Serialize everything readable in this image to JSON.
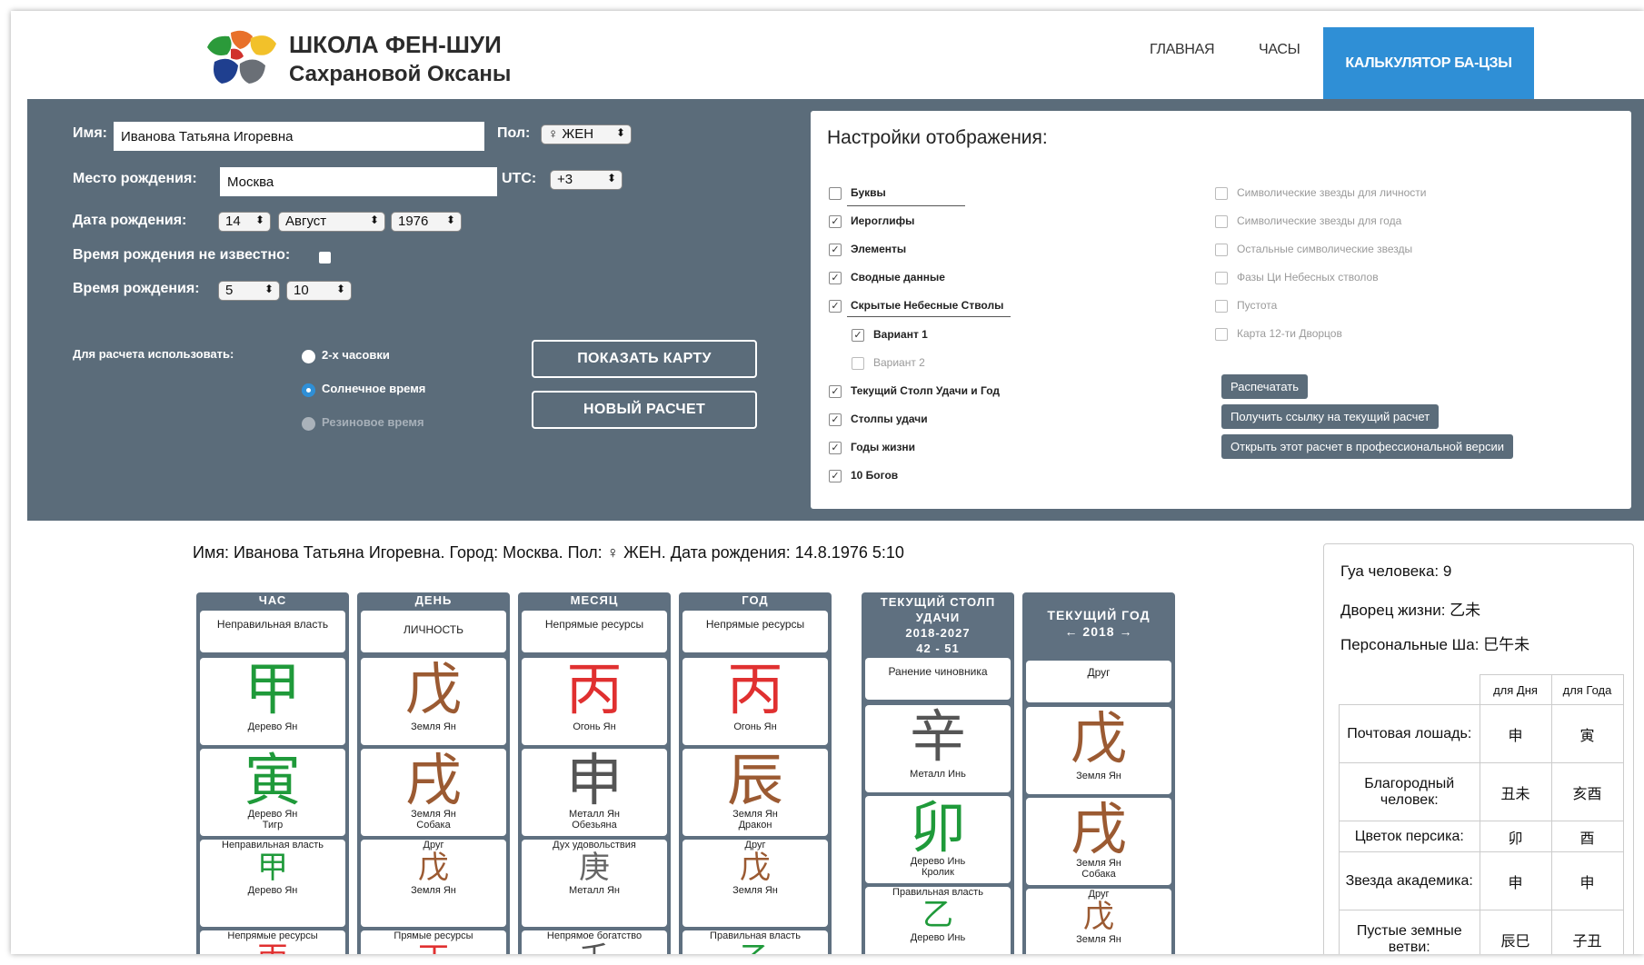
{
  "header": {
    "title": "ШКОЛА ФЕН-ШУИ",
    "subtitle": "Сахрановой Оксаны",
    "nav": [
      "ГЛАВНАЯ",
      "ЧАСЫ"
    ],
    "nav_active": "КАЛЬКУЛЯТОР БА-ЦЗЫ"
  },
  "form": {
    "name_label": "Имя:",
    "name_value": "Иванова Татьяна Игоревна",
    "gender_label": "Пол:",
    "gender_value": "♀ ЖЕН",
    "place_label": "Место рождения:",
    "place_value": "Москва",
    "utc_label": "UTC:",
    "utc_value": "+3",
    "date_label": "Дата рождения:",
    "day": "14",
    "month": "Август",
    "year": "1976",
    "time_unknown_label": "Время рождения не известно:",
    "time_label": "Время рождения:",
    "hour": "5",
    "minute": "10",
    "calc_label": "Для расчета использовать:",
    "radio": [
      "2-х часовки",
      "Солнечное время",
      "Резиновое время"
    ],
    "show_btn": "ПОКАЗАТЬ КАРТУ",
    "new_btn": "НОВЫЙ РАСЧЕТ"
  },
  "settings": {
    "title": "Настройки отображения:",
    "left": [
      {
        "label": "Буквы",
        "checked": false
      },
      {
        "label": "Иероглифы",
        "checked": true
      },
      {
        "label": "Элементы",
        "checked": true
      },
      {
        "label": "Сводные данные",
        "checked": true
      },
      {
        "label": "Скрытые Небесные Стволы",
        "checked": true
      },
      {
        "label": "Вариант 1",
        "checked": true
      },
      {
        "label": "Вариант 2",
        "checked": false
      },
      {
        "label": "Текущий Столп Удачи и Год",
        "checked": true
      },
      {
        "label": "Столпы удачи",
        "checked": true
      },
      {
        "label": "Годы жизни",
        "checked": true
      },
      {
        "label": "10 Богов",
        "checked": true
      }
    ],
    "right": [
      "Символические звезды для личности",
      "Символические звезды для года",
      "Остальные символические звезды",
      "Фазы Ци Небесных стволов",
      "Пустота",
      "Карта 12-ти Дворцов"
    ],
    "buttons": [
      "Распечатать",
      "Получить ссылку на текущий расчет",
      "Открыть этот расчет в профессиональной версии"
    ]
  },
  "summary": "Имя: Иванова Татьяна Игоревна. Город: Москва. Пол: ♀ ЖЕН. Дата рождения: 14.8.1976 5:10",
  "pillars": [
    {
      "head": "ЧАС",
      "god": "Неправильная власть",
      "stem": "甲",
      "stem_label": "Дерево Ян",
      "branch": "寅",
      "branch_label1": "Дерево Ян",
      "branch_label2": "Тигр",
      "h1_god": "Неправильная власть",
      "h1": "甲",
      "h1_label": "Дерево Ян",
      "h2_god": "Непрямые ресурсы",
      "h2": "丙"
    },
    {
      "head": "ДЕНЬ",
      "god": "ЛИЧНОСТЬ",
      "stem": "戊",
      "stem_label": "Земля Ян",
      "branch": "戌",
      "branch_label1": "Земля Ян",
      "branch_label2": "Собака",
      "h1_god": "Друг",
      "h1": "戊",
      "h1_label": "Земля Ян",
      "h2_god": "Прямые ресурсы",
      "h2": "丁"
    },
    {
      "head": "МЕСЯЦ",
      "god": "Непрямые ресурсы",
      "stem": "丙",
      "stem_label": "Огонь Ян",
      "branch": "申",
      "branch_label1": "Металл Ян",
      "branch_label2": "Обезьяна",
      "h1_god": "Дух удовольствия",
      "h1": "庚",
      "h1_label": "Металл Ян",
      "h2_god": "Непрямое богатство",
      "h2": "壬"
    },
    {
      "head": "ГОД",
      "god": "Непрямые ресурсы",
      "stem": "丙",
      "stem_label": "Огонь Ян",
      "branch": "辰",
      "branch_label1": "Земля Ян",
      "branch_label2": "Дракон",
      "h1_god": "Друг",
      "h1": "戊",
      "h1_label": "Земля Ян",
      "h2_god": "Правильная власть",
      "h2": "乙"
    }
  ],
  "luck": {
    "head": "ТЕКУЩИЙ СТОЛП УДАЧИ",
    "years": "2018-2027",
    "ages": "42 - 51",
    "god": "Ранение чиновника",
    "stem": "辛",
    "stem_label": "Металл Инь",
    "branch": "卯",
    "branch_label1": "Дерево Инь",
    "branch_label2": "Кролик",
    "h1_god": "Правильная власть",
    "h1": "乙",
    "h1_label": "Дерево Инь"
  },
  "year": {
    "head": "ТЕКУЩИЙ ГОД",
    "nav": "← 2018 →",
    "god": "Друг",
    "stem": "戊",
    "stem_label": "Земля Ян",
    "branch": "戌",
    "branch_label1": "Земля Ян",
    "branch_label2": "Собака",
    "h1_god": "Друг",
    "h1": "戊",
    "h1_label": "Земля Ян"
  },
  "card": {
    "gua": "Гуа человека: 9",
    "palace": "Дворец жизни: 乙未",
    "sha": "Персональные Ша: 巳午未",
    "col_day": "для Дня",
    "col_year": "для Года",
    "rows": [
      {
        "name": "Почтовая лошадь:",
        "day": "申",
        "year": "寅"
      },
      {
        "name": "Благородный человек:",
        "day": "丑未",
        "year": "亥酉"
      },
      {
        "name": "Цветок персика:",
        "day": "卯",
        "year": "酉"
      },
      {
        "name": "Звезда академика:",
        "day": "申",
        "year": "申"
      },
      {
        "name": "Пустые земные ветви:",
        "day": "辰巳",
        "year": "子丑"
      }
    ]
  }
}
